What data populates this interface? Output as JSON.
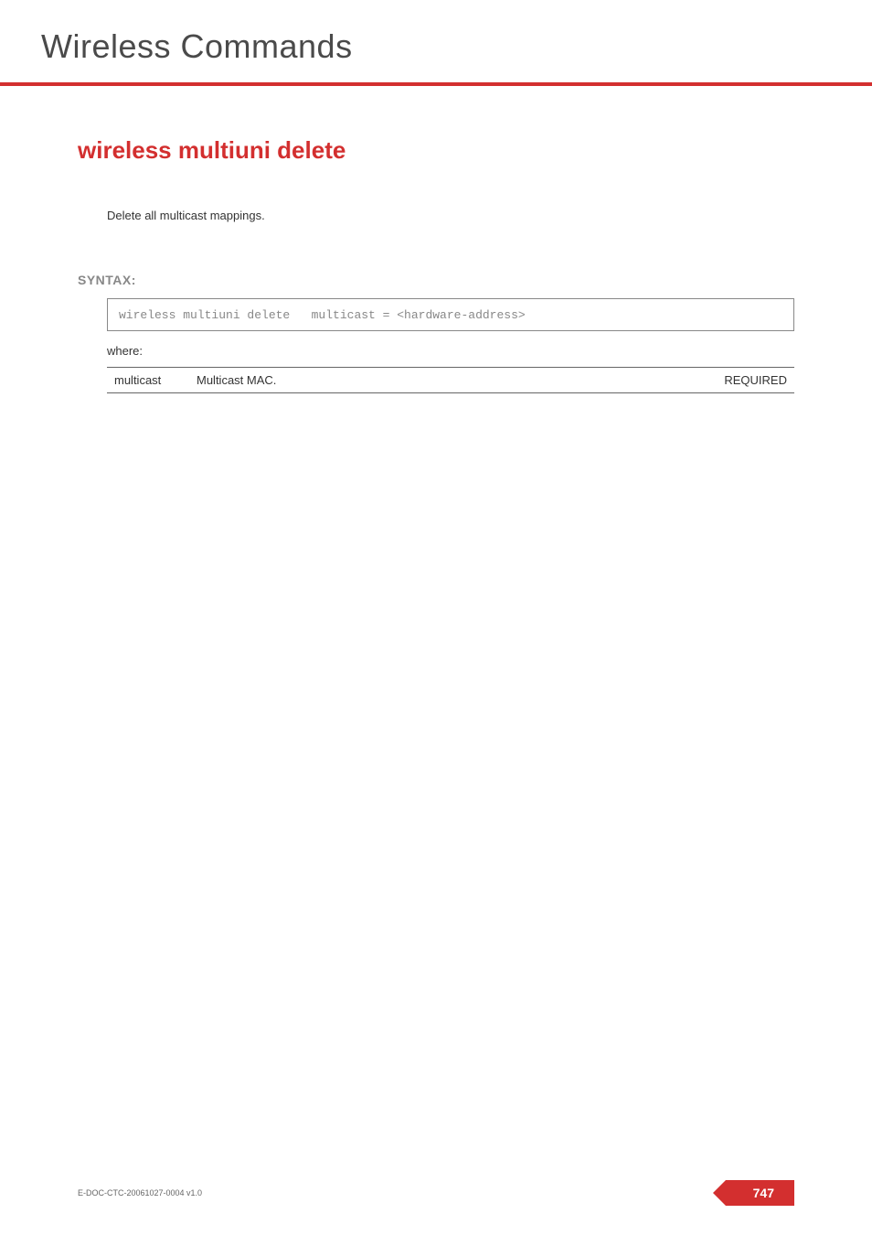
{
  "header": {
    "title": "Wireless Commands"
  },
  "command": {
    "title": "wireless multiuni delete",
    "description": "Delete all multicast mappings."
  },
  "syntax": {
    "label": "SYNTAX:",
    "code": "wireless multiuni delete   multicast = <hardware-address>",
    "where": "where:"
  },
  "params": [
    {
      "name": "multicast",
      "description": "Multicast MAC.",
      "requirement": "REQUIRED"
    }
  ],
  "footer": {
    "doc_id": "E-DOC-CTC-20061027-0004 v1.0",
    "page_number": "747"
  }
}
